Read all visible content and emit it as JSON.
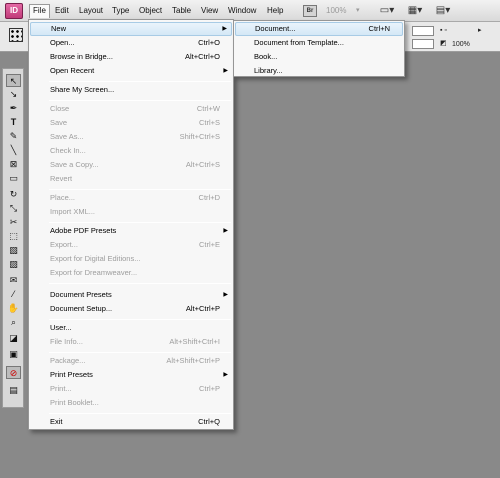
{
  "app": {
    "logo_text": "ID"
  },
  "menubar": {
    "items": [
      "File",
      "Edit",
      "Layout",
      "Type",
      "Object",
      "Table",
      "View",
      "Window",
      "Help"
    ],
    "active": "File",
    "bridge_badge": "Br",
    "zoom": "100%"
  },
  "control_panel": {
    "zoom_small": "100%"
  },
  "file_menu": {
    "items": [
      {
        "label": "New",
        "shortcut": "",
        "submenu": true,
        "enabled": true
      },
      {
        "label": "Open...",
        "shortcut": "Ctrl+O",
        "enabled": true
      },
      {
        "label": "Browse in Bridge...",
        "shortcut": "Alt+Ctrl+O",
        "enabled": true
      },
      {
        "label": "Open Recent",
        "shortcut": "",
        "submenu": true,
        "enabled": true
      },
      {
        "label": "Share My Screen...",
        "shortcut": "",
        "enabled": true
      },
      {
        "label": "Close",
        "shortcut": "Ctrl+W",
        "enabled": false
      },
      {
        "label": "Save",
        "shortcut": "Ctrl+S",
        "enabled": false
      },
      {
        "label": "Save As...",
        "shortcut": "Shift+Ctrl+S",
        "enabled": false
      },
      {
        "label": "Check In...",
        "shortcut": "",
        "enabled": false
      },
      {
        "label": "Save a Copy...",
        "shortcut": "Alt+Ctrl+S",
        "enabled": false
      },
      {
        "label": "Revert",
        "shortcut": "",
        "enabled": false
      },
      {
        "label": "Place...",
        "shortcut": "Ctrl+D",
        "enabled": false
      },
      {
        "label": "Import XML...",
        "shortcut": "",
        "enabled": false
      },
      {
        "label": "Adobe PDF Presets",
        "shortcut": "",
        "submenu": true,
        "enabled": true
      },
      {
        "label": "Export...",
        "shortcut": "Ctrl+E",
        "enabled": false
      },
      {
        "label": "Export for Digital Editions...",
        "shortcut": "",
        "enabled": false
      },
      {
        "label": "Export for Dreamweaver...",
        "shortcut": "",
        "enabled": false
      },
      {
        "label": "Document Presets",
        "shortcut": "",
        "submenu": true,
        "enabled": true
      },
      {
        "label": "Document Setup...",
        "shortcut": "Alt+Ctrl+P",
        "enabled": true
      },
      {
        "label": "User...",
        "shortcut": "",
        "enabled": true
      },
      {
        "label": "File Info...",
        "shortcut": "Alt+Shift+Ctrl+I",
        "enabled": false
      },
      {
        "label": "Package...",
        "shortcut": "Alt+Shift+Ctrl+P",
        "enabled": false
      },
      {
        "label": "Print Presets",
        "shortcut": "",
        "submenu": true,
        "enabled": true
      },
      {
        "label": "Print...",
        "shortcut": "Ctrl+P",
        "enabled": false
      },
      {
        "label": "Print Booklet...",
        "shortcut": "",
        "enabled": false
      },
      {
        "label": "Exit",
        "shortcut": "Ctrl+Q",
        "enabled": true
      }
    ]
  },
  "new_submenu": {
    "items": [
      {
        "label": "Document...",
        "shortcut": "Ctrl+N"
      },
      {
        "label": "Document from Template..."
      },
      {
        "label": "Book..."
      },
      {
        "label": "Library..."
      }
    ]
  },
  "tools": [
    "selection-tool",
    "direct-selection-tool",
    "pen-tool",
    "type-tool",
    "pencil-tool",
    "line-tool",
    "rectangle-frame-tool",
    "rectangle-tool",
    "rotate-tool",
    "scale-tool",
    "scissors-tool",
    "free-transform-tool",
    "gradient-tool",
    "gradient-feather-tool",
    "note-tool",
    "eyedropper-tool",
    "hand-tool",
    "zoom-tool",
    "fill-stroke-swatch",
    "apply-color",
    "normal-mode",
    "screen-mode"
  ],
  "colors": {
    "accent_hover": "#d4e8f6",
    "workspace": "#898989",
    "disabled_text": "#9d9d9d"
  }
}
